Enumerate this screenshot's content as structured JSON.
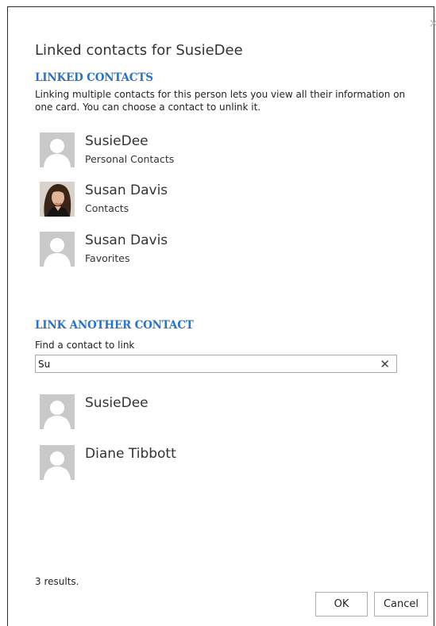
{
  "dialog": {
    "title": "Linked contacts for SusieDee",
    "close_glyph": "×"
  },
  "linked_section": {
    "heading": "LINKED CONTACTS",
    "description": "Linking multiple contacts for this person lets you view all their information on one card. You can choose a contact to unlink it.",
    "contacts": [
      {
        "name": "SusieDee",
        "source": "Personal Contacts",
        "avatar": "placeholder-person-icon"
      },
      {
        "name": "Susan Davis",
        "source": "Contacts",
        "avatar": "photo"
      },
      {
        "name": "Susan Davis",
        "source": "Favorites",
        "avatar": "placeholder-person-icon"
      }
    ]
  },
  "link_section": {
    "heading": "LINK ANOTHER CONTACT",
    "find_label": "Find a contact to link",
    "search_value": "Su",
    "clear_glyph": "✕",
    "results": [
      {
        "name": "SusieDee",
        "avatar": "placeholder-person-icon"
      },
      {
        "name": "Diane Tibbott",
        "avatar": "placeholder-person-icon"
      }
    ],
    "results_count_text": "3 results."
  },
  "buttons": {
    "ok": "OK",
    "cancel": "Cancel"
  },
  "colors": {
    "section_heading": "#2a73c5",
    "avatar_placeholder_bg": "#c9c9c9",
    "dialog_border": "#2b2b2b"
  }
}
